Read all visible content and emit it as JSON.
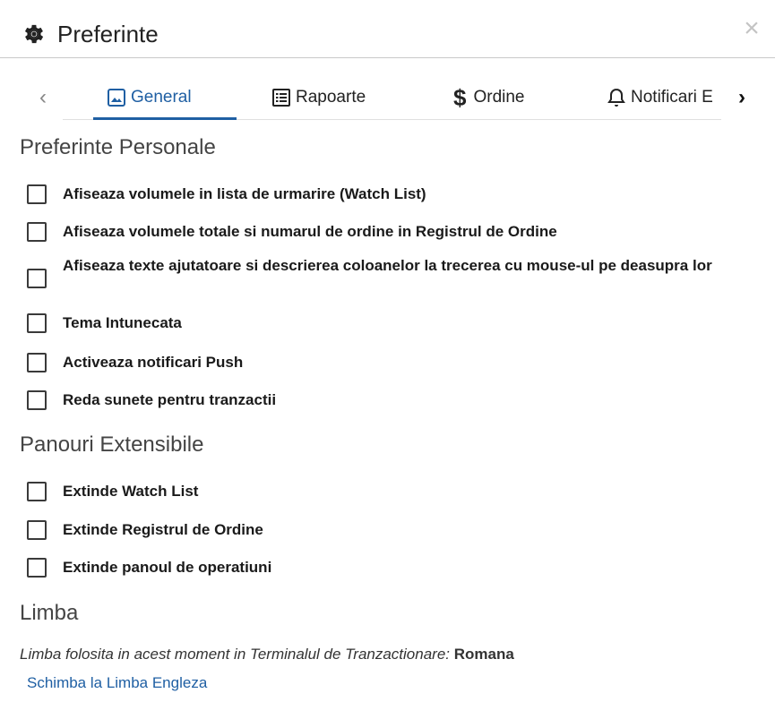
{
  "dialog": {
    "title": "Preferinte",
    "close_label": "×"
  },
  "tabs": {
    "prev_label": "‹",
    "next_label": "›",
    "items": [
      {
        "label": "General",
        "icon": "image-icon",
        "active": true
      },
      {
        "label": "Rapoarte",
        "icon": "list-icon",
        "active": false
      },
      {
        "label": "Ordine",
        "icon": "dollar-icon",
        "active": false
      },
      {
        "label": "Notificari E",
        "icon": "bell-icon",
        "active": false
      }
    ]
  },
  "personal": {
    "title": "Preferinte Personale",
    "options": [
      {
        "label": "Afiseaza volumele in lista de urmarire (Watch List)",
        "checked": false
      },
      {
        "label": "Afiseaza volumele totale si numarul de ordine in Registrul de Ordine",
        "checked": false
      },
      {
        "label": "Afiseaza texte ajutatoare si descrierea coloanelor la trecerea cu mouse-ul pe deasupra lor",
        "checked": false
      },
      {
        "label": "Tema Intunecata",
        "checked": false
      },
      {
        "label": "Activeaza notificari Push",
        "checked": false
      },
      {
        "label": "Reda sunete pentru tranzactii",
        "checked": false
      }
    ]
  },
  "panels": {
    "title": "Panouri Extensibile",
    "options": [
      {
        "label": "Extinde Watch List",
        "checked": false
      },
      {
        "label": "Extinde Registrul de Ordine",
        "checked": false
      },
      {
        "label": "Extinde panoul de operatiuni",
        "checked": false
      }
    ]
  },
  "language": {
    "title": "Limba",
    "current_text": "Limba folosita in acest moment in Terminalul de Tranzactionare:",
    "current_value": "Romana",
    "switch_link": "Schimba la Limba Engleza"
  },
  "colors": {
    "accent": "#1f5fa3",
    "border": "#c8c8c8"
  }
}
